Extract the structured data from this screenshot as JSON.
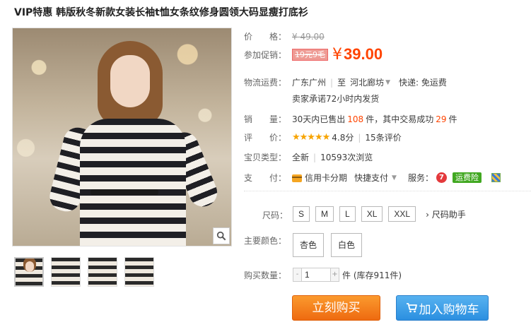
{
  "title": "VIP特惠 韩版秋冬新款女装长袖t恤女条纹修身圆领大码显瘦打底衫",
  "price": {
    "label": "价　　格：",
    "value": "¥ 49.00"
  },
  "promo": {
    "label": "参加促销：",
    "badge": "19元9毛",
    "currency": "¥",
    "value": "39.00"
  },
  "shipping": {
    "label": "物流运费：",
    "from": "广东广州",
    "separator": "|",
    "to_prefix": "至",
    "to": "河北廊坊",
    "fee": "快递: 免运费",
    "promise": "卖家承诺72小时内发货"
  },
  "sales": {
    "label": "销　　量：",
    "text1": "30天内已售出",
    "sold": "108",
    "text2": "件，其中交易成功",
    "success": "29",
    "text3": "件"
  },
  "rating": {
    "label": "评　　价：",
    "stars": "★★★★★",
    "score": "4.8分",
    "separator": "|",
    "reviews": "15条评价"
  },
  "item_type": {
    "label": "宝贝类型：",
    "condition": "全新",
    "separator": "|",
    "views": "10593次浏览"
  },
  "payment": {
    "label": "支　　付：",
    "credit": "信用卡分期",
    "quick": "快捷支付",
    "service_label": "服务：",
    "service_num": "7",
    "insurance": "运费险"
  },
  "size": {
    "label": "尺码：",
    "options": [
      "S",
      "M",
      "L",
      "XL",
      "XXL"
    ],
    "helper": "尺码助手"
  },
  "color": {
    "label": "主要颜色：",
    "options": [
      "杏色",
      "白色"
    ]
  },
  "quantity": {
    "label": "购买数量：",
    "value": "1",
    "minus": "-",
    "plus": "+",
    "stock": "件 (库存911件)"
  },
  "buttons": {
    "buy": "立刻购买",
    "cart": "加入购物车"
  },
  "colors": {
    "price": "#ff4400",
    "buy_button": "#f7811f",
    "cart_button": "#3a9ee8",
    "stars": "#f7a400"
  }
}
